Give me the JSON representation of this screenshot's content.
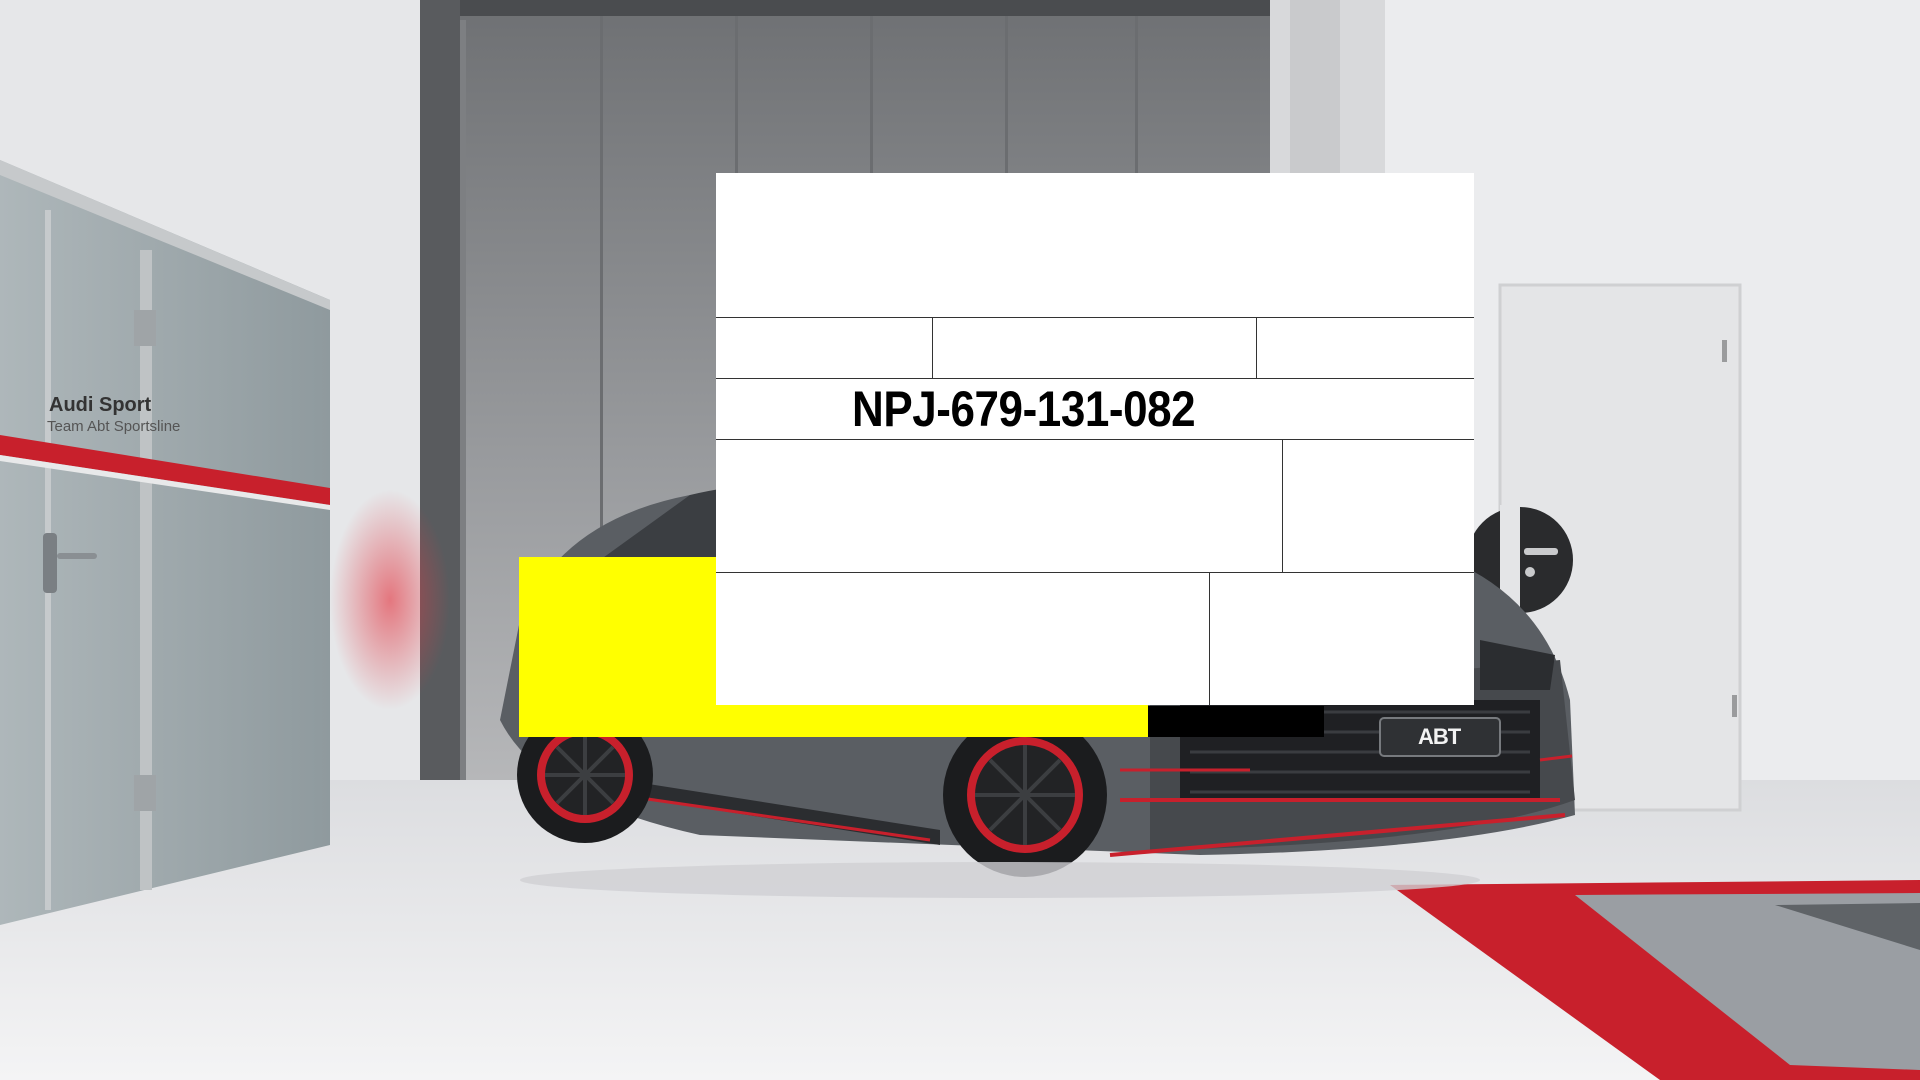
{
  "photo": {
    "wall_sign_brand": "Audi Sport",
    "wall_sign_sub": "Team Abt Sportsline",
    "plate_brand": "ABT",
    "colors": {
      "wall": "#e9eaec",
      "accent_red": "#c8202c",
      "car_body": "#5a5e63",
      "floor": "#eeeeef"
    }
  },
  "overlay": {
    "ticket_number": "NPJ-679-131-082",
    "highlight_color": "#ffff00",
    "bar_color": "#000000"
  }
}
